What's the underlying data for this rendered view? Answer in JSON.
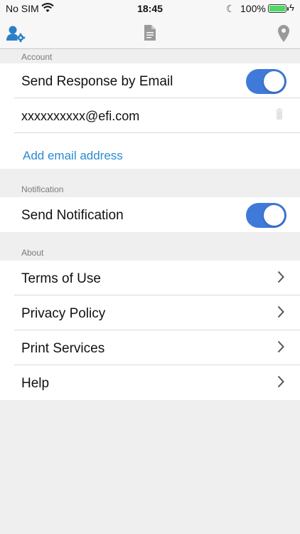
{
  "status_bar": {
    "carrier": "No SIM",
    "time": "18:45",
    "battery": "100%"
  },
  "toolbar": {
    "icons": [
      "user-settings-icon",
      "document-icon",
      "location-pin-icon"
    ],
    "accent_color": "#2a7fc6",
    "inactive_color": "#9a9a9a"
  },
  "sections": {
    "account": {
      "header": "Account",
      "send_response_label": "Send Response by Email",
      "send_response_on": true,
      "email": "xxxxxxxxxx@efi.com",
      "add_email_label": "Add email address"
    },
    "notification": {
      "header": "Notification",
      "send_notification_label": "Send Notification",
      "send_notification_on": true
    },
    "about": {
      "header": "About",
      "items": [
        "Terms of Use",
        "Privacy Policy",
        "Print Services",
        "Help"
      ]
    }
  },
  "colors": {
    "toggle_on": "#3f7ad9",
    "link": "#2a8bd1",
    "background": "#efefef"
  }
}
